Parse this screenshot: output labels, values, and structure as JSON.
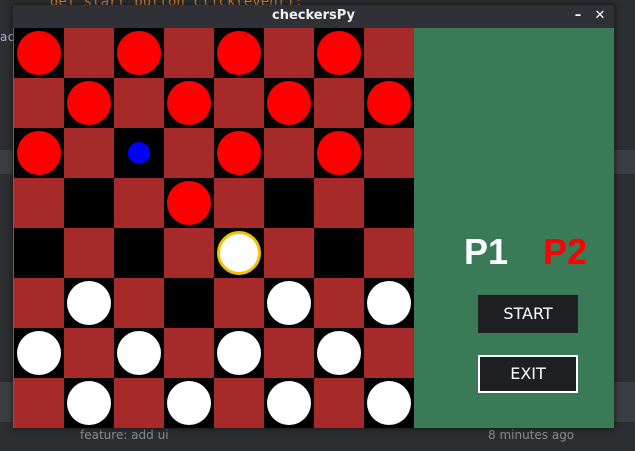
{
  "background": {
    "code_line": "def start_button_click(event):",
    "left_fragment": "act",
    "bottom_left": "feature: add ui",
    "bottom_right": "8 minutes ago"
  },
  "window": {
    "title": "checkersPy",
    "minimize_glyph": "–",
    "close_glyph": "✕"
  },
  "board": {
    "rows": 8,
    "cols": 8,
    "light_color": "#a62a2a",
    "dark_color": "#000000",
    "red_color": "#ff0000",
    "white_color": "#ffffff",
    "selected_color": "#f2c200",
    "marker_color": "#0000ff",
    "layout": [
      "R.R.R.R.",
      ".R.R.R.R",
      "R.b.R.R.",
      "...R....",
      "....S...",
      ".W...W.W",
      "W.W.W.W.",
      ".W.W.W.W"
    ]
  },
  "panel": {
    "p1_label": "P1",
    "p2_label": "P2",
    "p1_color": "#ffffff",
    "p2_color": "#ff0000",
    "start_label": "START",
    "exit_label": "EXIT"
  }
}
